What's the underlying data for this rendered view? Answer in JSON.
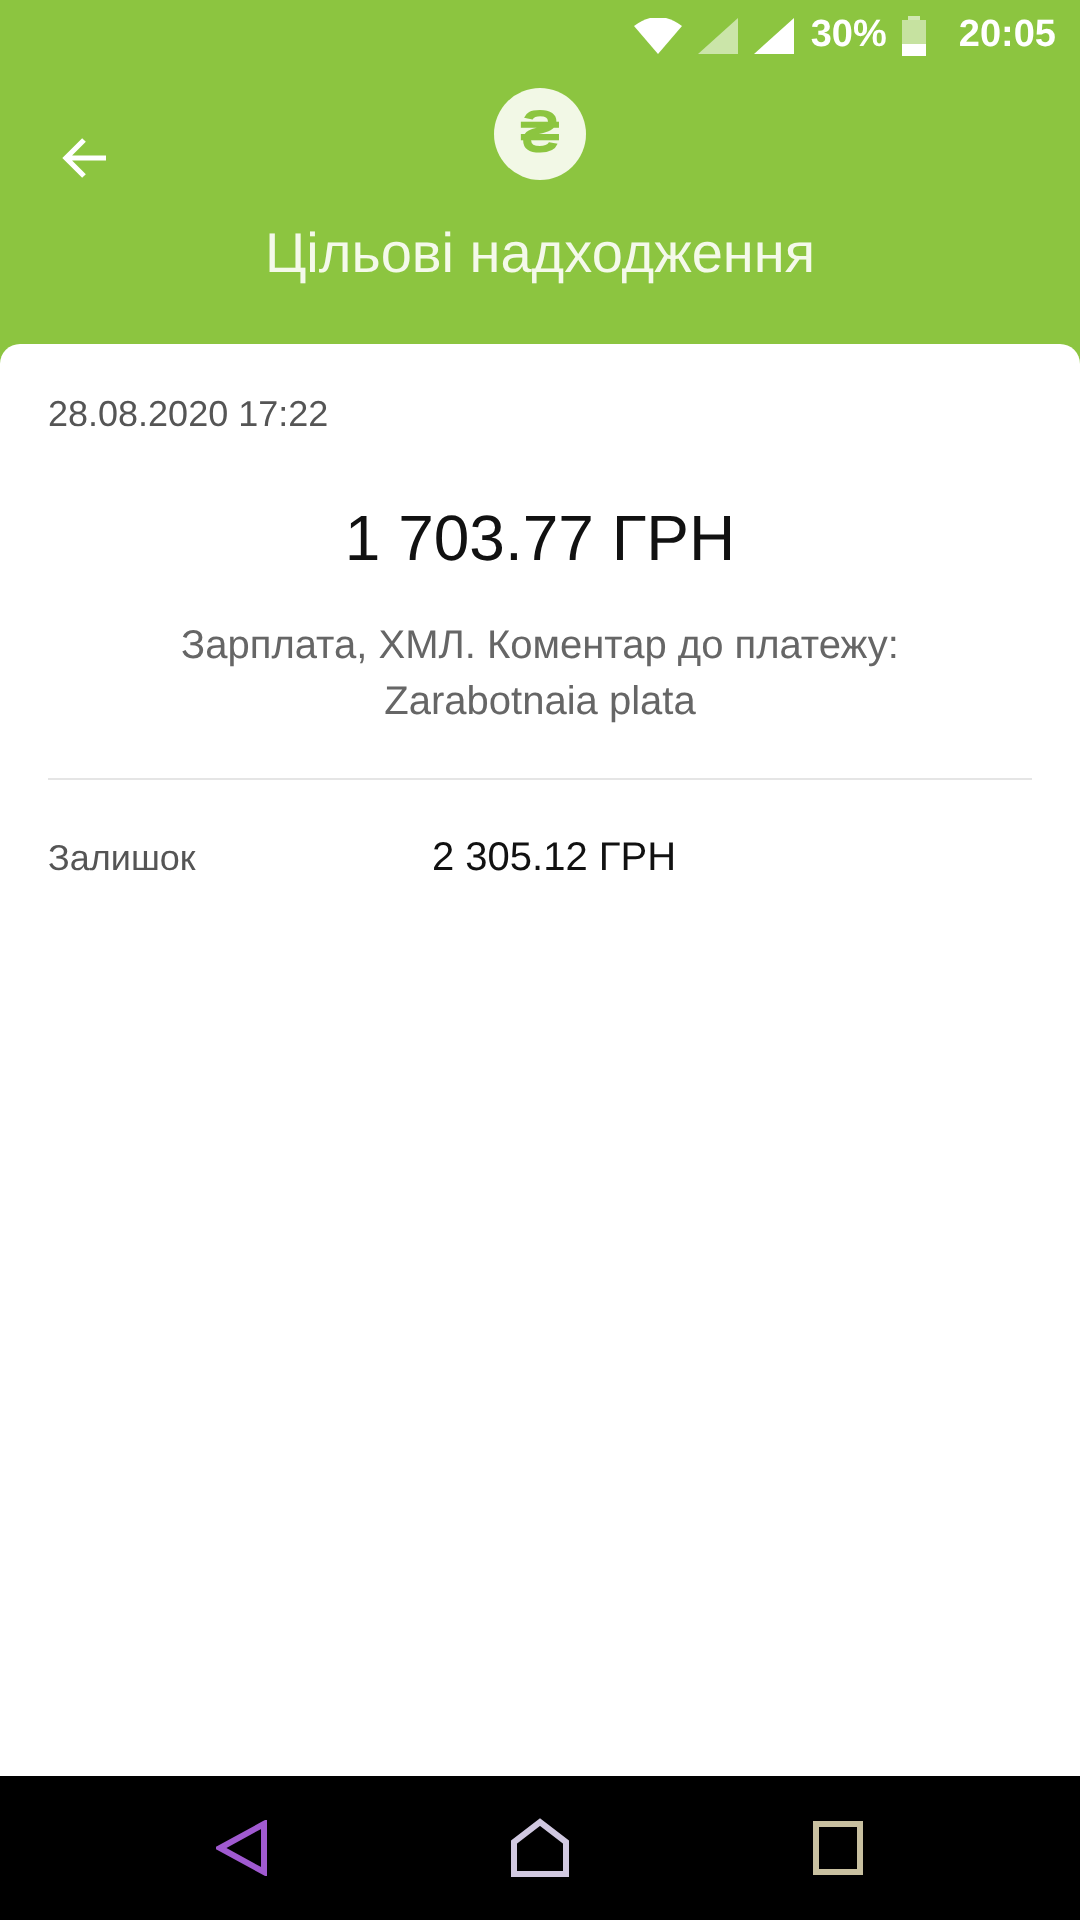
{
  "status_bar": {
    "battery": "30%",
    "time": "20:05"
  },
  "header": {
    "logo": "₴",
    "title": "Цільові надходження"
  },
  "transaction": {
    "datetime": "28.08.2020 17:22",
    "amount": "1 703.77 ГРН",
    "description": "Зарплата, ХМЛ. Коментар до платежу: Zarabotnaia plata"
  },
  "details": [
    {
      "label": "Залишок",
      "value": "2 305.12 ГРН"
    }
  ]
}
